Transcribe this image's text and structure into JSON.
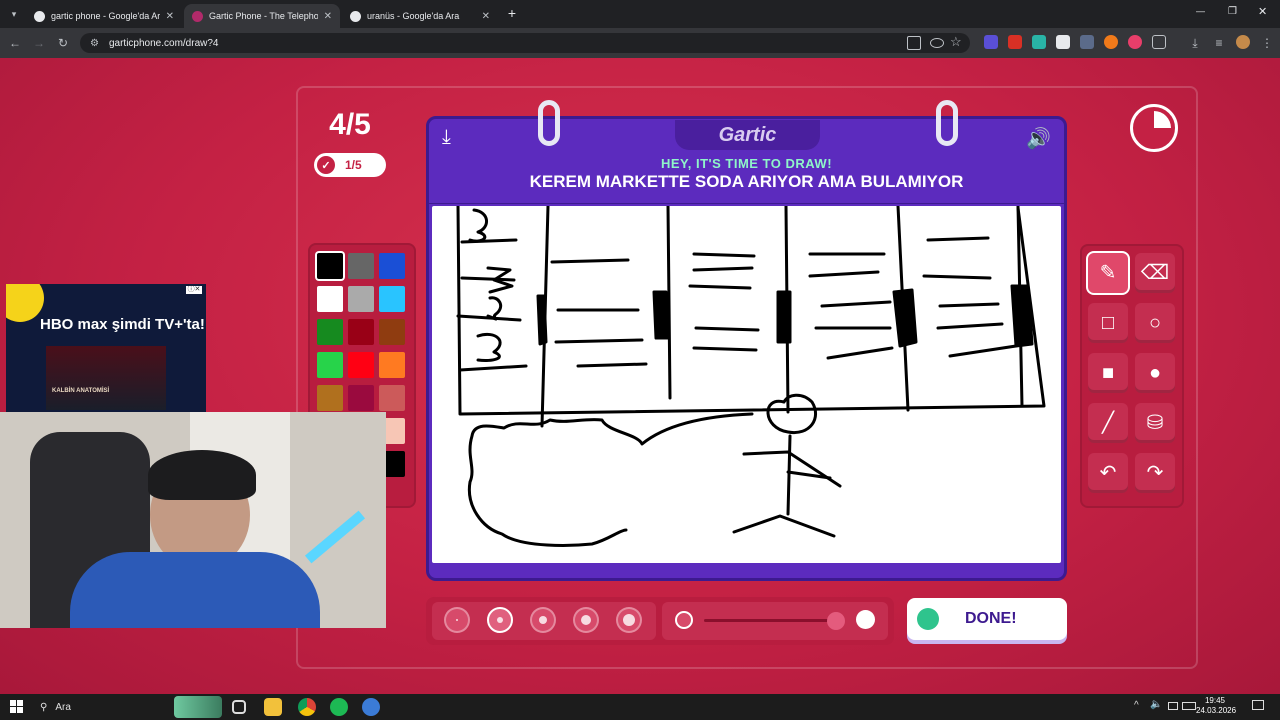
{
  "browser": {
    "tabs": [
      {
        "title": "gartic phone - Google'da Ara",
        "active": false
      },
      {
        "title": "Gartic Phone - The Telephone G",
        "active": true
      },
      {
        "title": "uranüs - Google'da Ara",
        "active": false
      }
    ],
    "new_tab": "+",
    "url": "garticphone.com/draw?4",
    "window_controls": {
      "minimize": "—",
      "restore": "❐",
      "close": "✕"
    }
  },
  "game": {
    "round": "4/5",
    "done_count": "1/5",
    "logo": "Gartic",
    "subtitle": "HEY, IT'S TIME TO DRAW!",
    "prompt": "KEREM MARKETTE SODA ARIYOR AMA BULAMIYOR",
    "done_button": "DONE!",
    "palette": [
      "#000000",
      "#666666",
      "#1a4fd6",
      "#ffffff",
      "#aaaaaa",
      "#29c4ff",
      "#168a1f",
      "#990016",
      "#8f3c10",
      "#27d34a",
      "#ff0013",
      "#ff7a21",
      "#b0701e",
      "#9a0a3e",
      "#cc5a5a",
      "#e6e6e6",
      "#e9a6a6",
      "#f7c6b5",
      "#f0f0f0",
      "#f9b4b4",
      "#000000"
    ],
    "selected_color": "#000000",
    "tools": [
      "pencil-icon",
      "eraser-icon",
      "square-outline-icon",
      "circle-outline-icon",
      "square-filled-icon",
      "circle-filled-icon",
      "line-icon",
      "bucket-icon",
      "undo-icon",
      "redo-icon"
    ],
    "selected_tool": "pencil-icon",
    "brush_sizes": 5,
    "selected_brush_size": 2,
    "opacity_level": 1.0
  },
  "overlays": {
    "ad_text": "HBO max şimdi TV+'ta!",
    "ad_movie": "KALBİN ANATOMİSİ"
  },
  "taskbar": {
    "search": "Ara",
    "time": "19:45",
    "date": "24.03.2026"
  }
}
